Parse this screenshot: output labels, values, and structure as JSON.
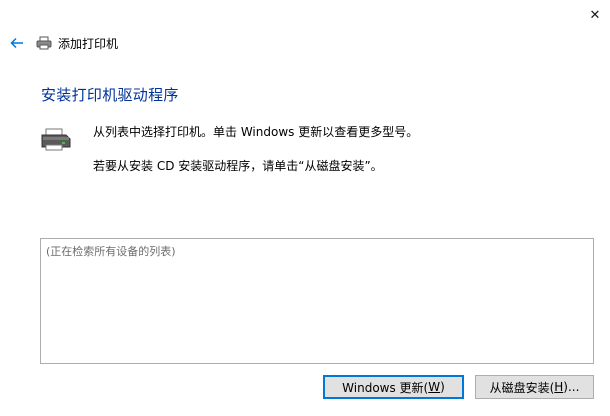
{
  "window": {
    "close_glyph": "✕"
  },
  "titlebar": {
    "back_icon": "back-arrow-icon",
    "printer_icon": "printer-icon",
    "title": "添加打印机"
  },
  "main": {
    "heading": "安装打印机驱动程序",
    "icon": "printer-icon",
    "description_line1": "从列表中选择打印机。单击 Windows 更新以查看更多型号。",
    "description_line2": "若要从安装 CD 安装驱动程序，请单击“从磁盘安装”。"
  },
  "list": {
    "placeholder": "(正在检索所有设备的列表)"
  },
  "buttons": {
    "windows_update_prefix": "Windows 更新(",
    "windows_update_accel": "W",
    "windows_update_suffix": ")",
    "have_disk_prefix": "从磁盘安装(",
    "have_disk_accel": "H",
    "have_disk_suffix": ")..."
  },
  "colors": {
    "accent": "#0078d7",
    "heading": "#003399"
  }
}
